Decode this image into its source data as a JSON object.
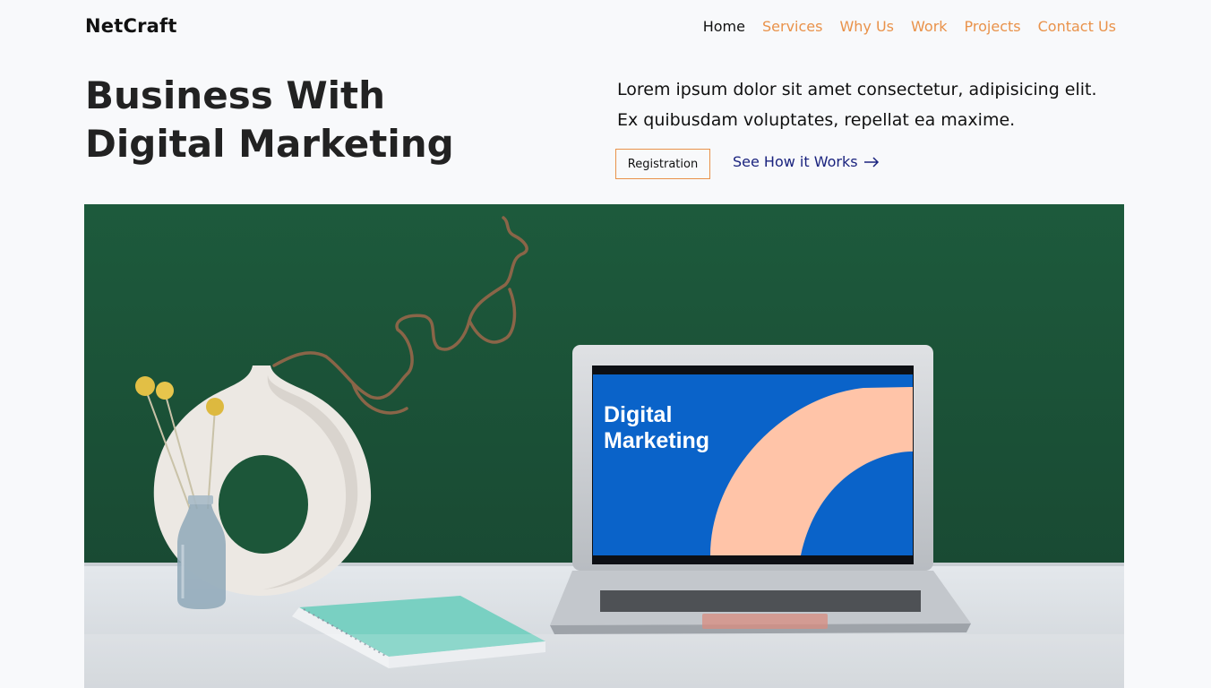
{
  "nav": {
    "brand": "NetCraft",
    "links": [
      {
        "label": "Home",
        "active": true
      },
      {
        "label": "Services",
        "active": false
      },
      {
        "label": "Why Us",
        "active": false
      },
      {
        "label": "Work",
        "active": false
      },
      {
        "label": "Projects",
        "active": false
      },
      {
        "label": "Contact Us",
        "active": false
      }
    ]
  },
  "hero": {
    "title_line1": "Business With",
    "title_line2": "Digital Marketing",
    "desc_line1": "Lorem ipsum dolor sit amet consectetur, adipisicing elit.",
    "desc_line2": "Ex quibusdam voluptates, repellat ea maxime.",
    "register_label": "Registration",
    "how_label": "See How it Works",
    "how_icon": "arrow-right-icon"
  },
  "image": {
    "screen_line1": "Digital",
    "screen_line2": "Marketing"
  },
  "colors": {
    "accent": "#e9924a",
    "link": "#1a237e",
    "wall": "#1b4d34",
    "screen_blue": "#0a63c9",
    "screen_peach": "#ffc4a8"
  }
}
